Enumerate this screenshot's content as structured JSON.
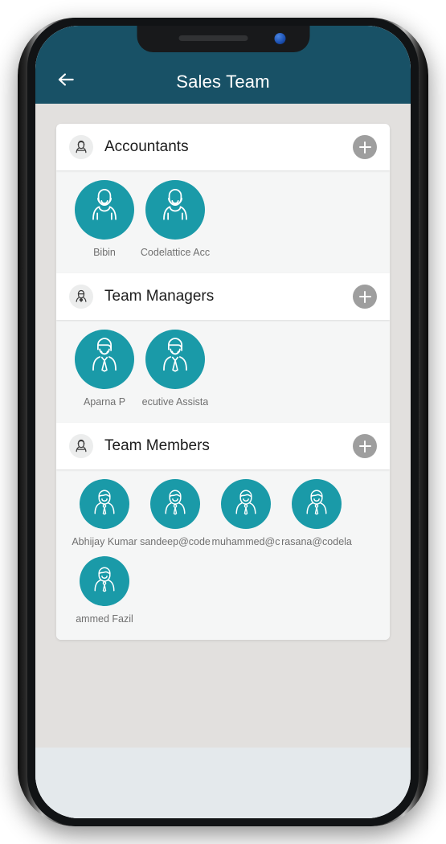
{
  "device": {
    "notch": {
      "speaker_name": "earpiece-speaker",
      "camera_name": "front-camera"
    },
    "buttons": {
      "silent": "silent-switch",
      "volume_up": "volume-up-button",
      "volume_down": "volume-down-button",
      "power": "power-button"
    }
  },
  "appbar": {
    "title": "Sales Team",
    "back_icon": "arrow-left-icon",
    "background": "#185166",
    "title_color": "#ffffff"
  },
  "theme": {
    "accent": "#1a9aa8",
    "page_background": "#e2e0de",
    "card_background": "#f5f6f6",
    "header_background": "#ffffff",
    "add_button_color": "#9e9e9e",
    "name_color": "#707070"
  },
  "groups": [
    {
      "id": "accountants",
      "title": "Accountants",
      "icon": "accountant-person-icon",
      "add_label": "+",
      "avatar_style": "accountant",
      "members": [
        {
          "name": "Bibin",
          "avatar": "accountant-avatar"
        },
        {
          "name": "Codelattice Acc",
          "avatar": "accountant-avatar"
        }
      ]
    },
    {
      "id": "team-managers",
      "title": "Team Managers",
      "icon": "manager-person-icon",
      "add_label": "+",
      "avatar_style": "manager",
      "members": [
        {
          "name": "Aparna P",
          "avatar": "manager-avatar"
        },
        {
          "name": "ecutive Assista",
          "avatar": "manager-avatar"
        }
      ]
    },
    {
      "id": "team-members",
      "title": "Team Members",
      "icon": "member-person-icon",
      "add_label": "+",
      "avatar_style": "member",
      "members": [
        {
          "name": "Abhijay Kumar",
          "avatar": "member-avatar"
        },
        {
          "name": "sandeep@code",
          "avatar": "member-avatar"
        },
        {
          "name": "muhammed@c",
          "avatar": "member-avatar"
        },
        {
          "name": "rasana@codela",
          "avatar": "member-avatar"
        },
        {
          "name": "ammed Fazil",
          "avatar": "member-avatar"
        }
      ]
    }
  ]
}
